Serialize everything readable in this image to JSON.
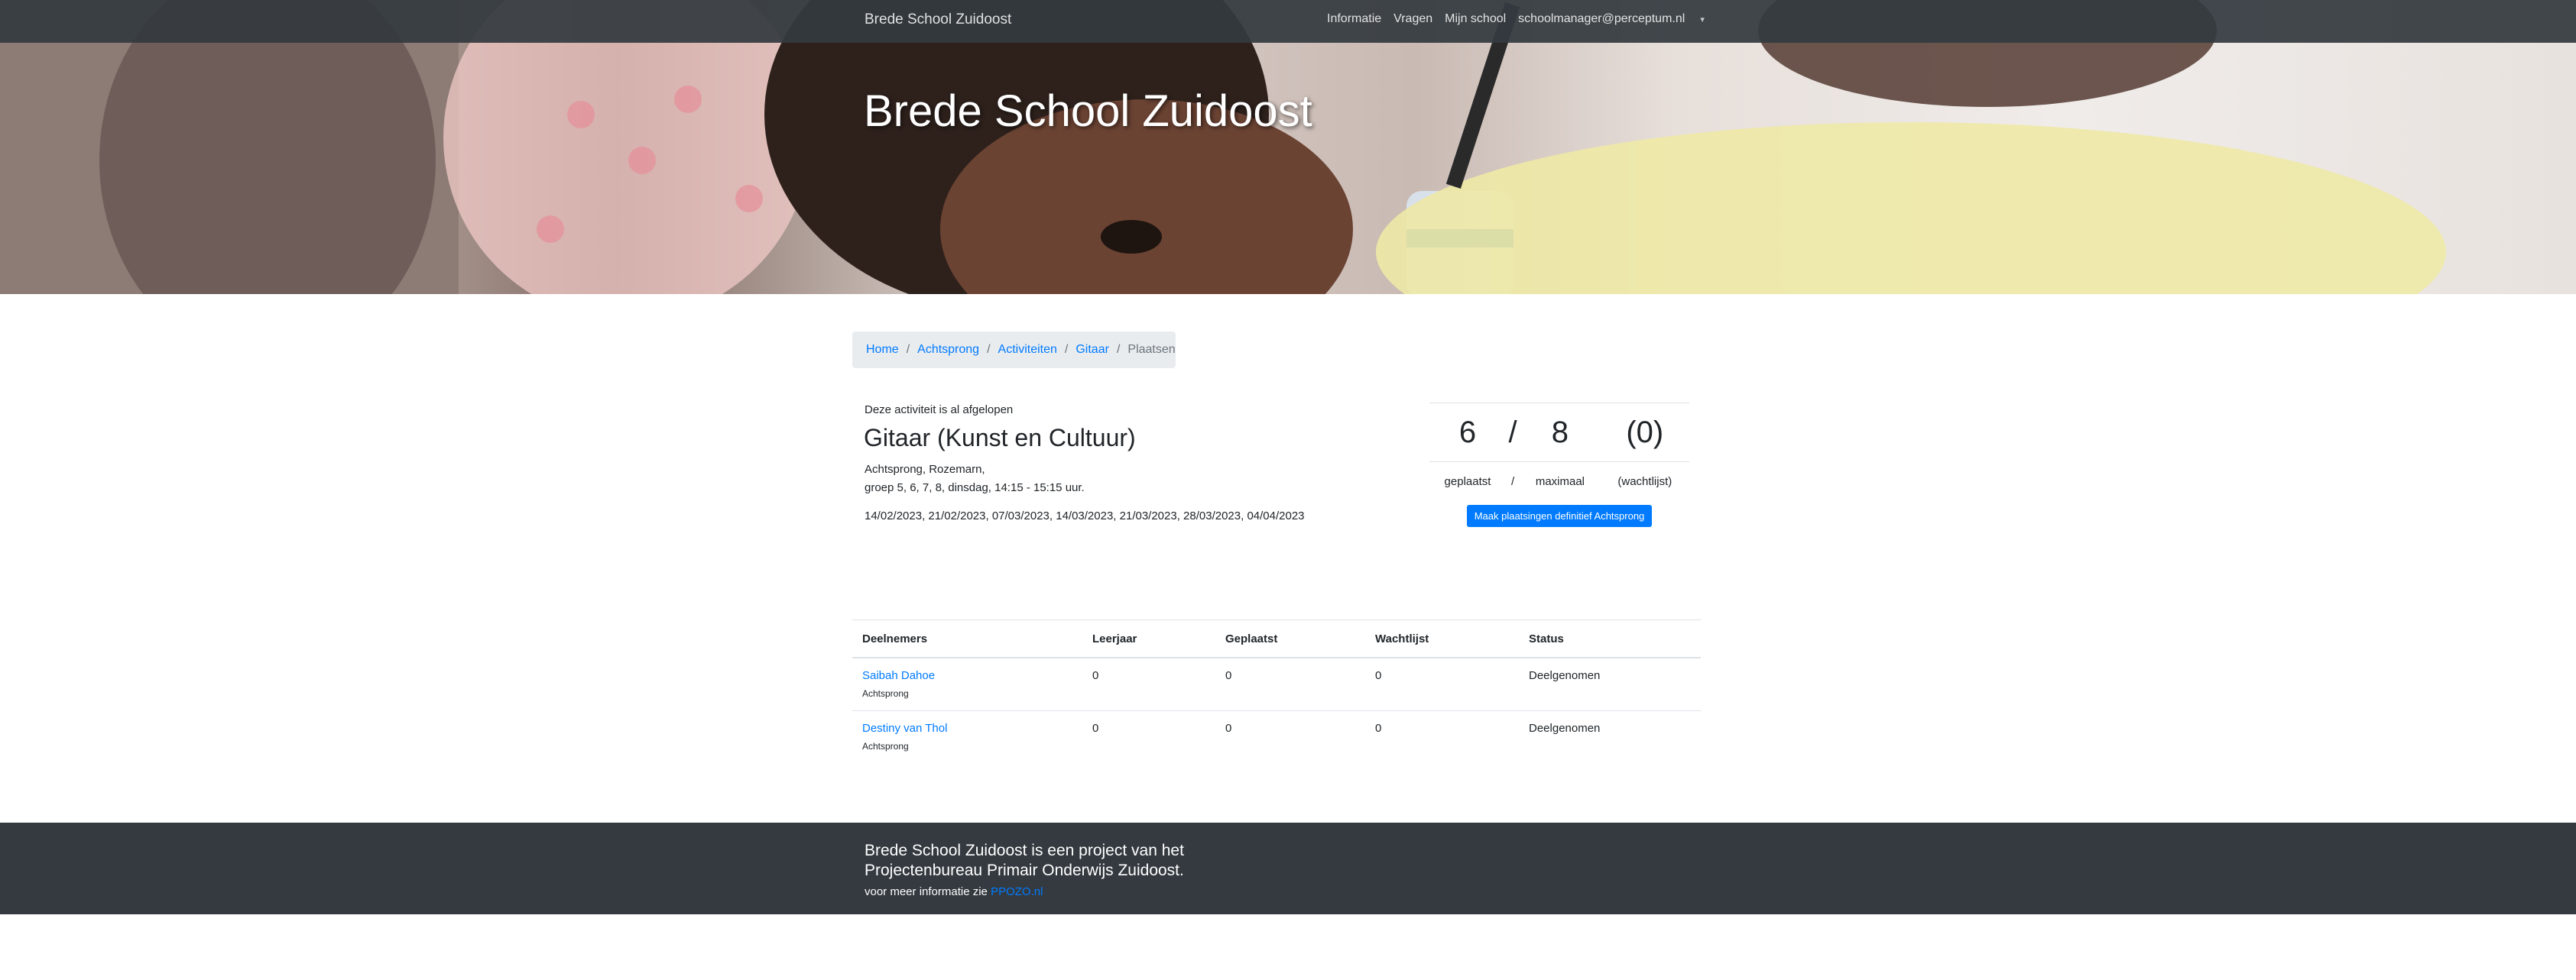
{
  "navbar": {
    "brand": "Brede School Zuidoost",
    "links": [
      "Informatie",
      "Vragen",
      "Mijn school",
      "schoolmanager@perceptum.nl"
    ],
    "dropdown_icon": "caret-down-icon"
  },
  "hero": {
    "title": "Brede School Zuidoost"
  },
  "breadcrumb": {
    "items": [
      "Home",
      "Achtsprong",
      "Activiteiten",
      "Gitaar"
    ],
    "active": "Plaatsen"
  },
  "activity": {
    "notice": "Deze activiteit is al afgelopen",
    "title": "Gitaar (Kunst en Cultuur)",
    "location": "Achtsprong, Rozemarn,",
    "schedule": "groep 5, 6, 7, 8, dinsdag, 14:15 - 15:15 uur.",
    "dates": "14/02/2023, 21/02/2023, 07/03/2023, 14/03/2023, 21/03/2023, 28/03/2023, 04/04/2023"
  },
  "stats": {
    "placed": "6",
    "sep": "/",
    "max": "8",
    "waitlist": "(0)",
    "placed_label": "geplaatst",
    "max_label": "maximaal",
    "waitlist_label": "(wachtlijst)",
    "button": "Maak plaatsingen definitief Achtsprong"
  },
  "participants": {
    "headers": [
      "Deelnemers",
      "Leerjaar",
      "Geplaatst",
      "Wachtlijst",
      "Status"
    ],
    "rows": [
      {
        "name": "Saibah Dahoe",
        "school": "Achtsprong",
        "leerjaar": "0",
        "geplaatst": "0",
        "wachtlijst": "0",
        "status": "Deelgenomen"
      },
      {
        "name": "Destiny van Thol",
        "school": "Achtsprong",
        "leerjaar": "0",
        "geplaatst": "0",
        "wachtlijst": "0",
        "status": "Deelgenomen"
      }
    ]
  },
  "footer": {
    "text": "Brede School Zuidoost is een project van het Projectenbureau Primair Onderwijs Zuidoost.",
    "more_prefix": "voor meer informatie zie",
    "more_link": "PPOZO.nl"
  },
  "colors": {
    "navbar": "#343a40",
    "link": "#007bff",
    "footer": "#343a40",
    "breadcrumb_bg": "#e9ecef"
  }
}
